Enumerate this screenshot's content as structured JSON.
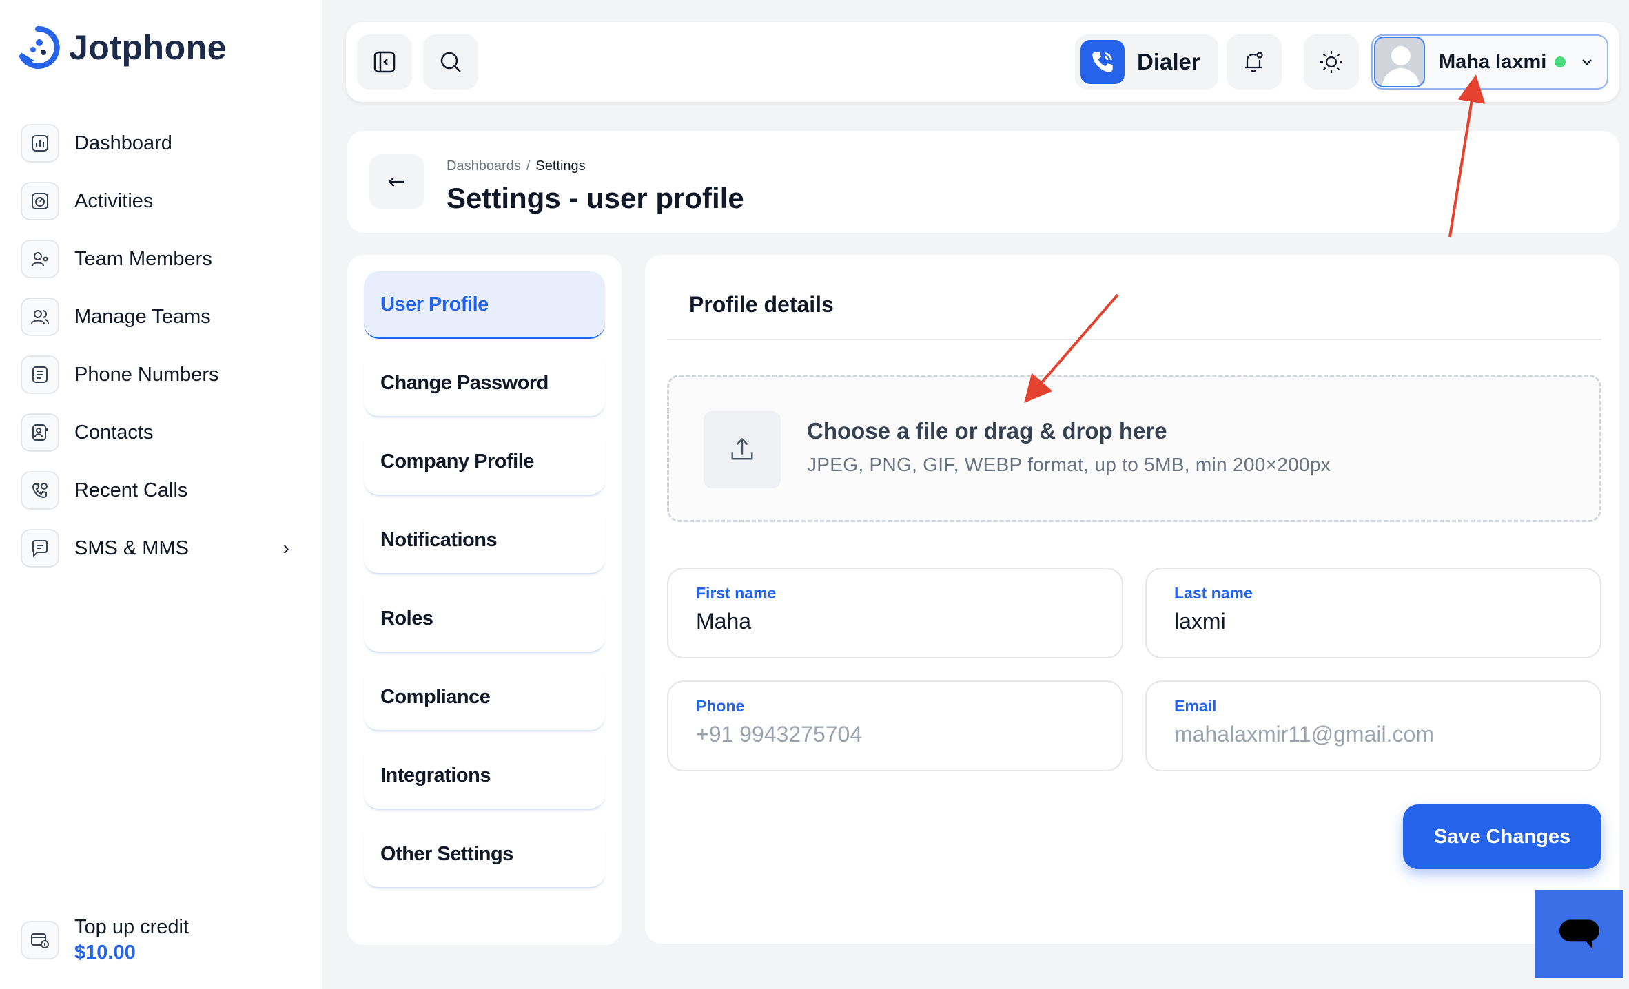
{
  "app": {
    "name": "Jotphone"
  },
  "sidebar": {
    "items": [
      {
        "label": "Dashboard",
        "icon": "dashboard-icon"
      },
      {
        "label": "Activities",
        "icon": "activities-icon"
      },
      {
        "label": "Team Members",
        "icon": "team-members-icon"
      },
      {
        "label": "Manage Teams",
        "icon": "manage-teams-icon"
      },
      {
        "label": "Phone Numbers",
        "icon": "phone-numbers-icon"
      },
      {
        "label": "Contacts",
        "icon": "contacts-icon"
      },
      {
        "label": "Recent Calls",
        "icon": "recent-calls-icon"
      },
      {
        "label": "SMS & MMS",
        "icon": "sms-icon",
        "chevron": "›"
      }
    ],
    "topup": {
      "title": "Top up credit",
      "amount": "$10.00"
    }
  },
  "header": {
    "dialer_label": "Dialer",
    "user_name": "Maha laxmi",
    "status_color": "#4ade80"
  },
  "breadcrumb": {
    "parent": "Dashboards",
    "separator": "/",
    "current": "Settings"
  },
  "page": {
    "title": "Settings - user profile"
  },
  "settings_menu": [
    {
      "label": "User Profile",
      "active": true
    },
    {
      "label": "Change Password"
    },
    {
      "label": "Company Profile"
    },
    {
      "label": "Notifications"
    },
    {
      "label": "Roles"
    },
    {
      "label": "Compliance"
    },
    {
      "label": "Integrations"
    },
    {
      "label": "Other Settings"
    }
  ],
  "profile": {
    "section_title": "Profile details",
    "upload": {
      "title": "Choose a file or drag & drop here",
      "subtitle": "JPEG, PNG, GIF, WEBP format, up to 5MB, min 200×200px"
    },
    "fields": {
      "first_name": {
        "label": "First name",
        "value": "Maha"
      },
      "last_name": {
        "label": "Last name",
        "value": "laxmi"
      },
      "phone": {
        "label": "Phone",
        "value": "+91 9943275704"
      },
      "email": {
        "label": "Email",
        "value": "mahalaxmir11@gmail.com"
      }
    },
    "save_label": "Save Changes"
  },
  "colors": {
    "accent": "#2563eb",
    "annotation_arrow": "#e5432f"
  }
}
